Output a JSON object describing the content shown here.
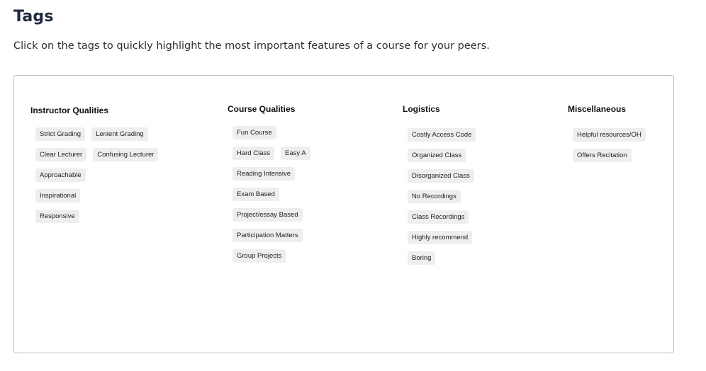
{
  "page": {
    "title": "Tags",
    "subtitle": "Click on the tags to quickly highlight the most important features of a course for your peers."
  },
  "groups": {
    "instructor": {
      "title": "Instructor Qualities",
      "tags": [
        "Strict Grading",
        "Lenient Grading",
        "Clear Lecturer",
        "Confusing Lecturer",
        "Approachable",
        "Inspirational",
        "Responsive"
      ]
    },
    "course": {
      "title": "Course Qualities",
      "tags": [
        "Fun Course",
        "Hard Class",
        "Easy A",
        "Reading Intensive",
        "Exam Based",
        "Project/essay Based",
        "Participation Matters",
        "Group Projects"
      ]
    },
    "logistics": {
      "title": "Logistics",
      "tags": [
        "Costly Access Code",
        "Organized Class",
        "Disorganized Class",
        "No Recordings",
        "Class Recordings",
        "Highly recommend",
        "Boring"
      ]
    },
    "misc": {
      "title": "Miscellaneous",
      "tags": [
        "Helpful resources/OH",
        "Offers Recitation"
      ]
    }
  }
}
